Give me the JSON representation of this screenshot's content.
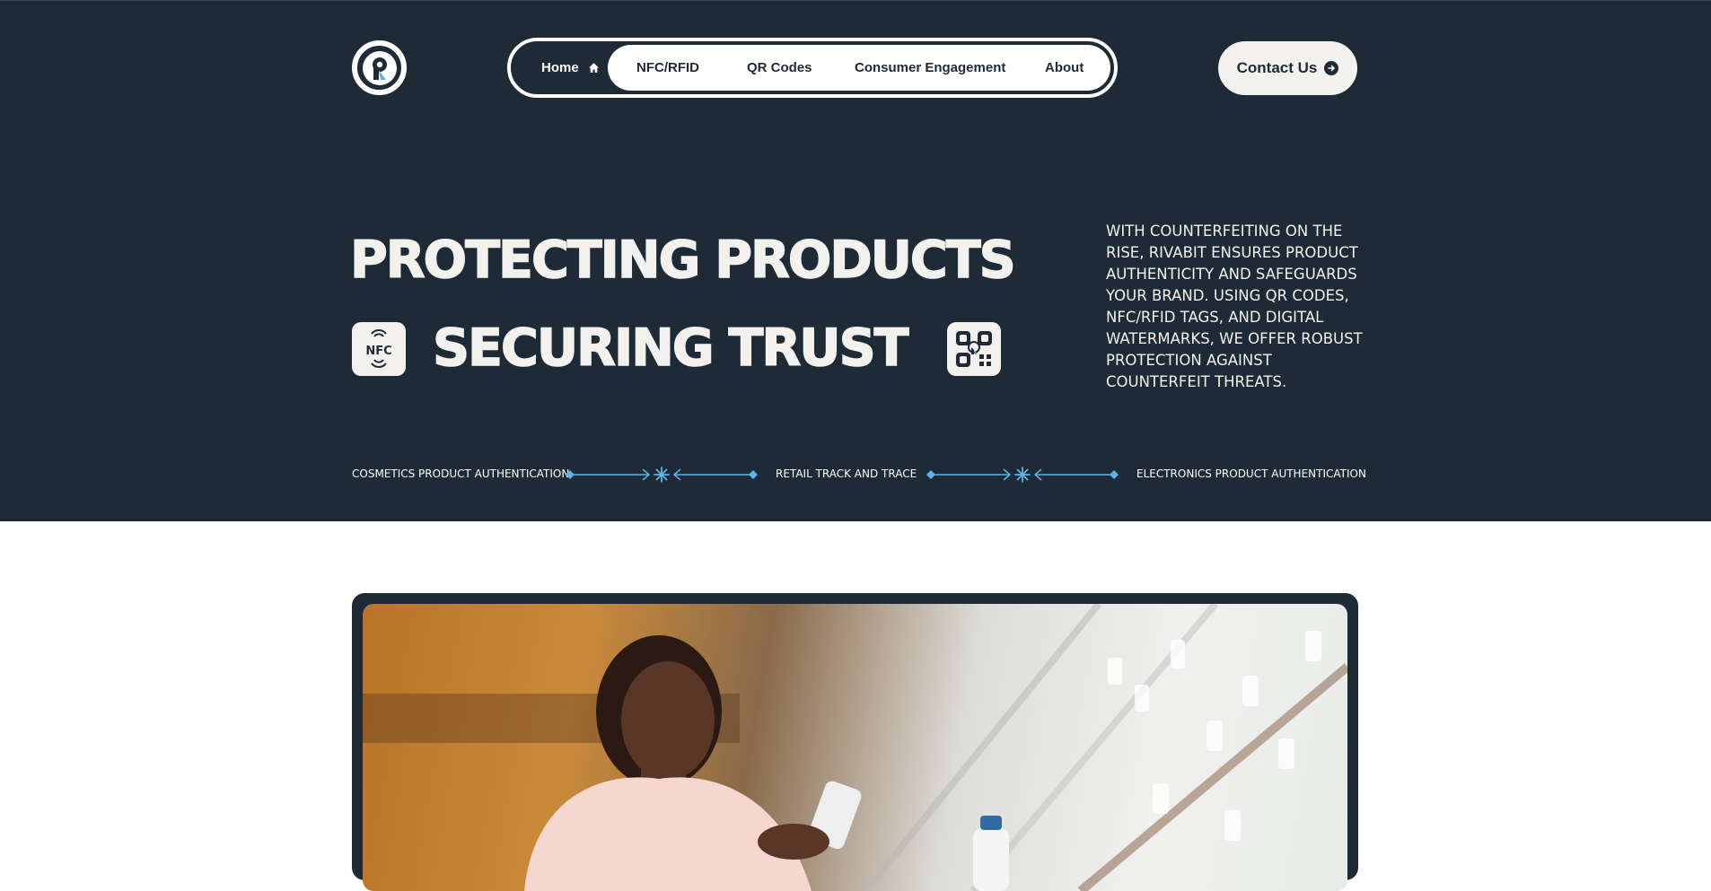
{
  "header": {
    "logo_alt": "Rivabit logo",
    "nav": {
      "home": "Home",
      "items": [
        "NFC/RFID",
        "QR Codes",
        "Consumer Engagement",
        "About"
      ]
    },
    "contact_label": "Contact Us"
  },
  "hero": {
    "line1": "PROTECTING PRODUCTS",
    "line2": "SECURING TRUST",
    "nfc_tile_text": "NFC",
    "description": "WITH COUNTERFEITING ON THE RISE, RIVABIT ENSURES PRODUCT AUTHENTICITY AND SAFEGUARDS YOUR BRAND. USING QR CODES, NFC/RFID TAGS, AND DIGITAL WATERMARKS, WE OFFER ROBUST PROTECTION AGAINST COUNTERFEIT THREATS."
  },
  "services": [
    "COSMETICS PRODUCT AUTHENTICATION",
    "RETAIL TRACK AND TRACE",
    "ELECTRONICS PRODUCT AUTHENTICATION"
  ],
  "colors": {
    "dark": "#1e2a35",
    "light": "#f3f1ee",
    "accent": "#5fb2e8"
  },
  "icons": [
    "logo-icon",
    "home-icon",
    "arrow-right-circle-icon",
    "nfc-icon",
    "qr-code-icon",
    "sparkle-icon"
  ]
}
